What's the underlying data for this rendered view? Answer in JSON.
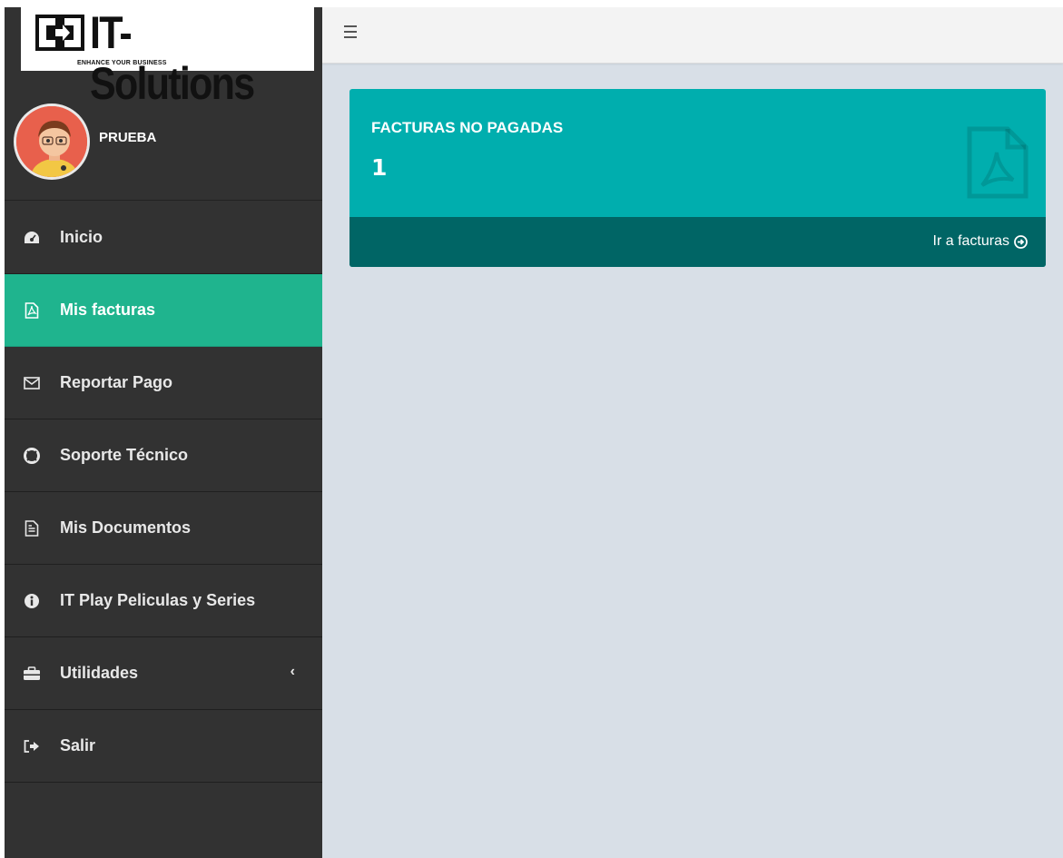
{
  "brand": {
    "name": "IT-Solutions",
    "tagline": "ENHANCE YOUR BUSINESS"
  },
  "user": {
    "name": "PRUEBA"
  },
  "sidebar": {
    "items": [
      {
        "label": "Inicio",
        "icon": "dashboard-icon"
      },
      {
        "label": "Mis facturas",
        "icon": "pdf-file-icon",
        "active": true
      },
      {
        "label": "Reportar Pago",
        "icon": "envelope-icon"
      },
      {
        "label": "Soporte Técnico",
        "icon": "life-ring-icon"
      },
      {
        "label": "Mis Documentos",
        "icon": "document-icon"
      },
      {
        "label": "IT Play Peliculas y Series",
        "icon": "info-circle-icon"
      },
      {
        "label": "Utilidades",
        "icon": "briefcase-icon",
        "has_submenu": true
      },
      {
        "label": "Salir",
        "icon": "sign-out-icon"
      }
    ]
  },
  "card": {
    "title": "FACTURAS NO PAGADAS",
    "value": "1",
    "link_label": "Ir a facturas",
    "icon": "pdf-file-icon"
  },
  "colors": {
    "sidebar_bg": "#323232",
    "active_item": "#1fb48e",
    "card_bg": "#00aeae",
    "card_footer": "#006565",
    "content_bg": "#d8dfe7"
  }
}
